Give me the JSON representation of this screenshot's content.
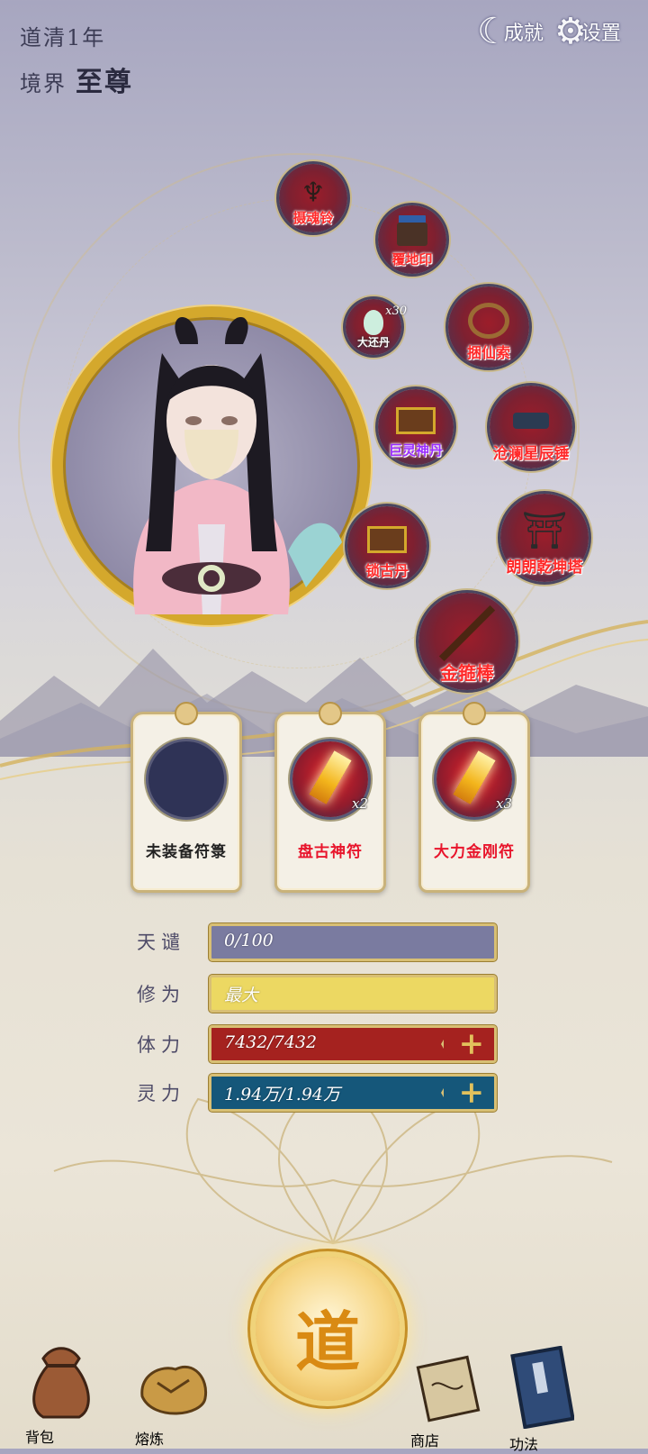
{
  "header": {
    "era": "道清1年",
    "realm_label": "境界",
    "realm_value": "至尊",
    "achievements_label": "成就",
    "settings_label": "设置"
  },
  "equipment": [
    {
      "label": "摄魂铃",
      "count": ""
    },
    {
      "label": "覆地印",
      "count": ""
    },
    {
      "label": "大还丹",
      "count": "x30"
    },
    {
      "label": "捆仙索",
      "count": ""
    },
    {
      "label": "巨灵神丹",
      "count": ""
    },
    {
      "label": "沧澜星辰锤",
      "count": ""
    },
    {
      "label": "锁古丹",
      "count": ""
    },
    {
      "label": "朗朗乾坤塔",
      "count": ""
    },
    {
      "label": "金箍棒",
      "count": ""
    }
  ],
  "talismans": [
    {
      "name": "未装备符箓",
      "count": ""
    },
    {
      "name": "盘古神符",
      "count": "x2"
    },
    {
      "name": "大力金刚符",
      "count": "x3"
    }
  ],
  "stats": {
    "tianqian": {
      "label": "天谴",
      "value": "0/100",
      "fraction": 0
    },
    "xiuli": {
      "label": "修为",
      "value": "最大",
      "fraction": 1
    },
    "tili": {
      "label": "体力",
      "value": "7432/7432",
      "fraction": 1
    },
    "lingli": {
      "label": "灵力",
      "value": "1.94万/1.94万",
      "fraction": 1
    }
  },
  "nav": {
    "bag": "背包",
    "refine": "熔炼",
    "dao": "道",
    "shop": "商店",
    "skills": "功法"
  },
  "colors": {
    "gold": "#d4a82c",
    "hp_red": "#a5221f",
    "mp_teal": "#15577a",
    "xiu_yellow": "#ecd862",
    "tian_slate": "#7a7ba0"
  }
}
